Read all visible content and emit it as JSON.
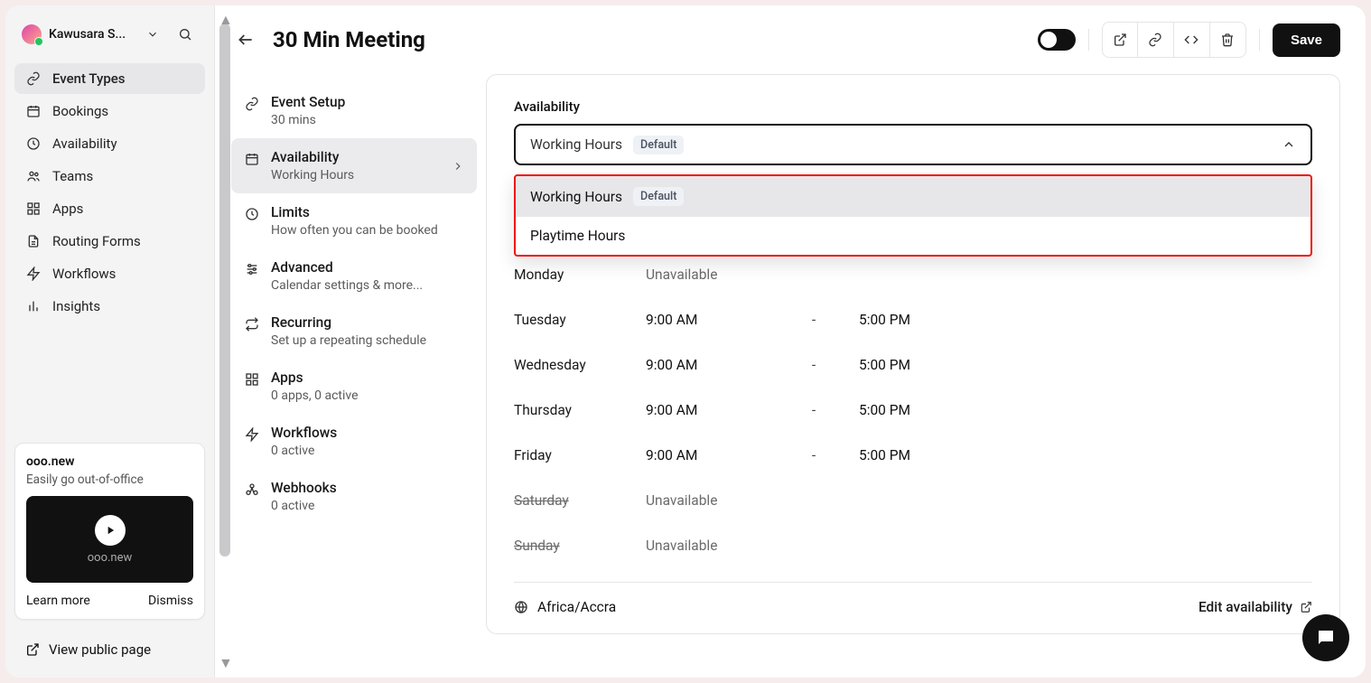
{
  "user": {
    "name": "Kawusara S..."
  },
  "sidebar": {
    "items": [
      {
        "label": "Event Types"
      },
      {
        "label": "Bookings"
      },
      {
        "label": "Availability"
      },
      {
        "label": "Teams"
      },
      {
        "label": "Apps"
      },
      {
        "label": "Routing Forms"
      },
      {
        "label": "Workflows"
      },
      {
        "label": "Insights"
      }
    ],
    "promo": {
      "title": "ooo.new",
      "subtitle": "Easily go out-of-office",
      "media_label": "ooo.new",
      "learn": "Learn more",
      "dismiss": "Dismiss"
    },
    "public_page": "View public page"
  },
  "header": {
    "title": "30 Min Meeting",
    "save": "Save"
  },
  "settings": [
    {
      "title": "Event Setup",
      "sub": "30 mins"
    },
    {
      "title": "Availability",
      "sub": "Working Hours"
    },
    {
      "title": "Limits",
      "sub": "How often you can be booked"
    },
    {
      "title": "Advanced",
      "sub": "Calendar settings & more..."
    },
    {
      "title": "Recurring",
      "sub": "Set up a repeating schedule"
    },
    {
      "title": "Apps",
      "sub": "0 apps, 0 active"
    },
    {
      "title": "Workflows",
      "sub": "0 active"
    },
    {
      "title": "Webhooks",
      "sub": "0 active"
    }
  ],
  "panel": {
    "label": "Availability",
    "selected": {
      "name": "Working Hours",
      "badge": "Default"
    },
    "options": [
      {
        "name": "Working Hours",
        "badge": "Default"
      },
      {
        "name": "Playtime Hours"
      }
    ],
    "schedule": [
      {
        "day": "Monday",
        "unavailable": "Unavailable"
      },
      {
        "day": "Tuesday",
        "start": "9:00 AM",
        "dash": "-",
        "end": "5:00 PM"
      },
      {
        "day": "Wednesday",
        "start": "9:00 AM",
        "dash": "-",
        "end": "5:00 PM"
      },
      {
        "day": "Thursday",
        "start": "9:00 AM",
        "dash": "-",
        "end": "5:00 PM"
      },
      {
        "day": "Friday",
        "start": "9:00 AM",
        "dash": "-",
        "end": "5:00 PM"
      },
      {
        "day": "Saturday",
        "unavailable": "Unavailable",
        "off": true
      },
      {
        "day": "Sunday",
        "unavailable": "Unavailable",
        "off": true
      }
    ],
    "timezone": "Africa/Accra",
    "edit": "Edit availability"
  }
}
